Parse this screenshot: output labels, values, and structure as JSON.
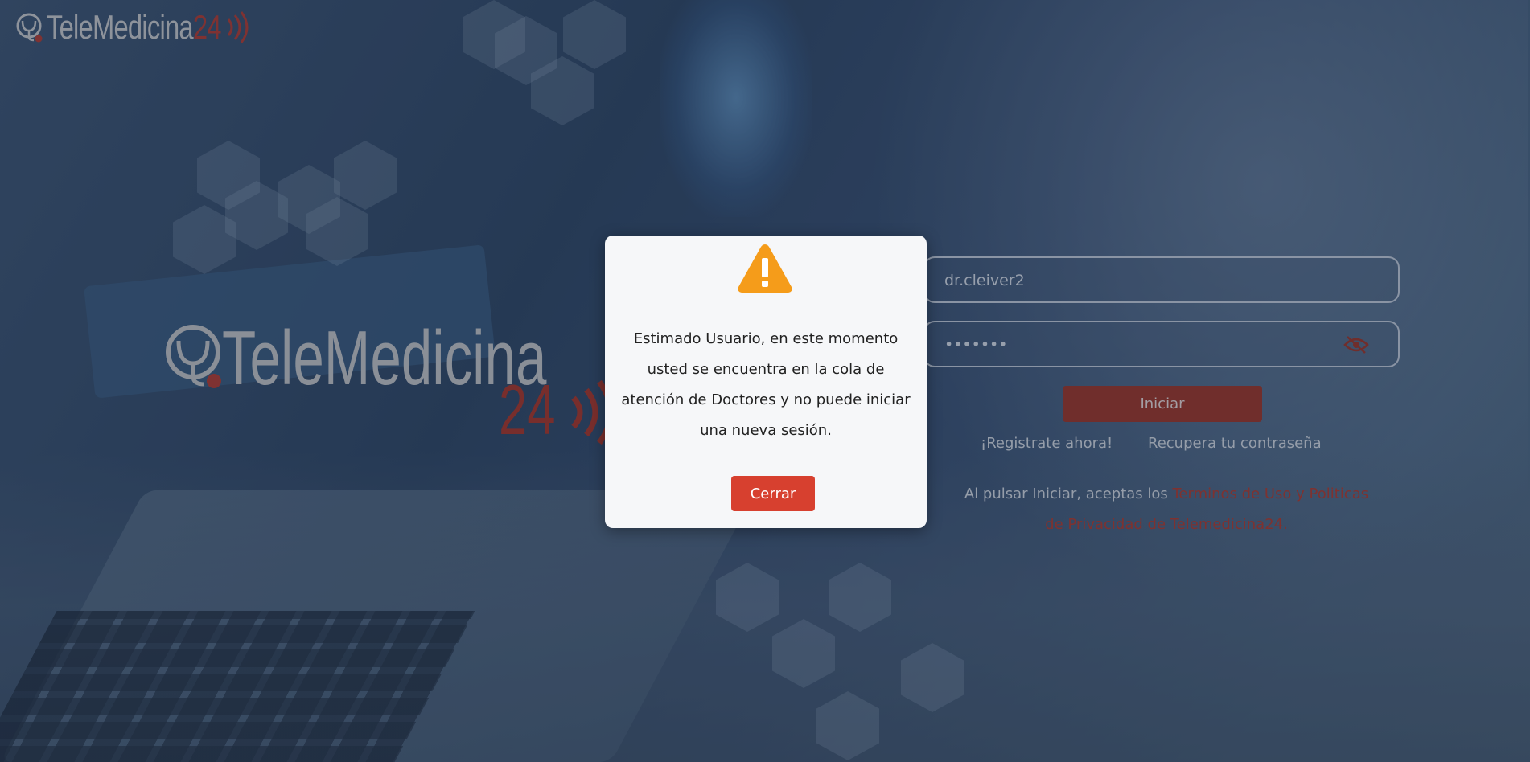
{
  "brand": {
    "name": "TeleMedicina",
    "number": "24",
    "primary_color": "#b33a2e",
    "logo_text_color": "#c9c9c9"
  },
  "login": {
    "username_value": "dr.cleiver2",
    "password_value": "•••••••",
    "submit_label": "Iniciar",
    "register_link": "¡Registrate ahora!",
    "recover_link": "Recupera tu contraseña",
    "terms_prefix": "Al pulsar Iniciar, aceptas los ",
    "terms_link": "Terminos de Uso y Politicas de Privacidad de Telemedicina24.",
    "password_toggle_icon": "eye-slash-icon"
  },
  "modal": {
    "icon": "warning-triangle-icon",
    "icon_color": "#f59c1a",
    "message": "Estimado Usuario, en este momento usted se encuentra en la cola de atención de Doctores y no puede iniciar una nueva sesión.",
    "close_label": "Cerrar",
    "close_color": "#d7402f"
  }
}
